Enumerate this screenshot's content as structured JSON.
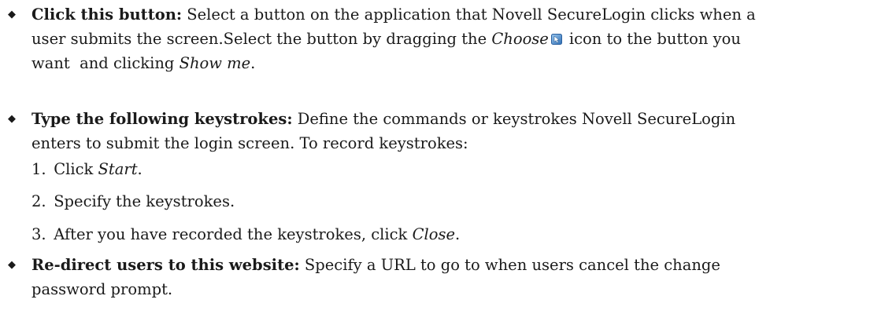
{
  "bullets": [
    {
      "term": "Click this button:",
      "line1": " Select a button on the application that Novell SecureLogin clicks when a",
      "line2_before_icon_a": "user submits the screen.Select the button by dragging the ",
      "line2_italic_choose": "Choose",
      "line2_after_icon": "icon to the button you",
      "line3_before": "want  and clicking ",
      "line3_italic": "Show me",
      "line3_after": "."
    },
    {
      "term": "Type the following keystrokes:",
      "line1": " Define the commands or keystrokes Novell SecureLogin",
      "line2": "enters to submit the login screen. To record keystrokes:"
    },
    {
      "term": "Re-direct users to this website:",
      "line1": " Specify a URL to go to when users cancel the change",
      "line2": "password prompt."
    }
  ],
  "steps": [
    {
      "num": "1.",
      "before": "Click ",
      "italic": "Start",
      "after": "."
    },
    {
      "num": "2.",
      "before": "Specify the keystrokes.",
      "italic": "",
      "after": ""
    },
    {
      "num": "3.",
      "before": "After you have recorded the keystrokes, click ",
      "italic": "Close",
      "after": "."
    }
  ],
  "bullet_symbol": "◆",
  "icons": {
    "choose": "choose-target-icon"
  }
}
